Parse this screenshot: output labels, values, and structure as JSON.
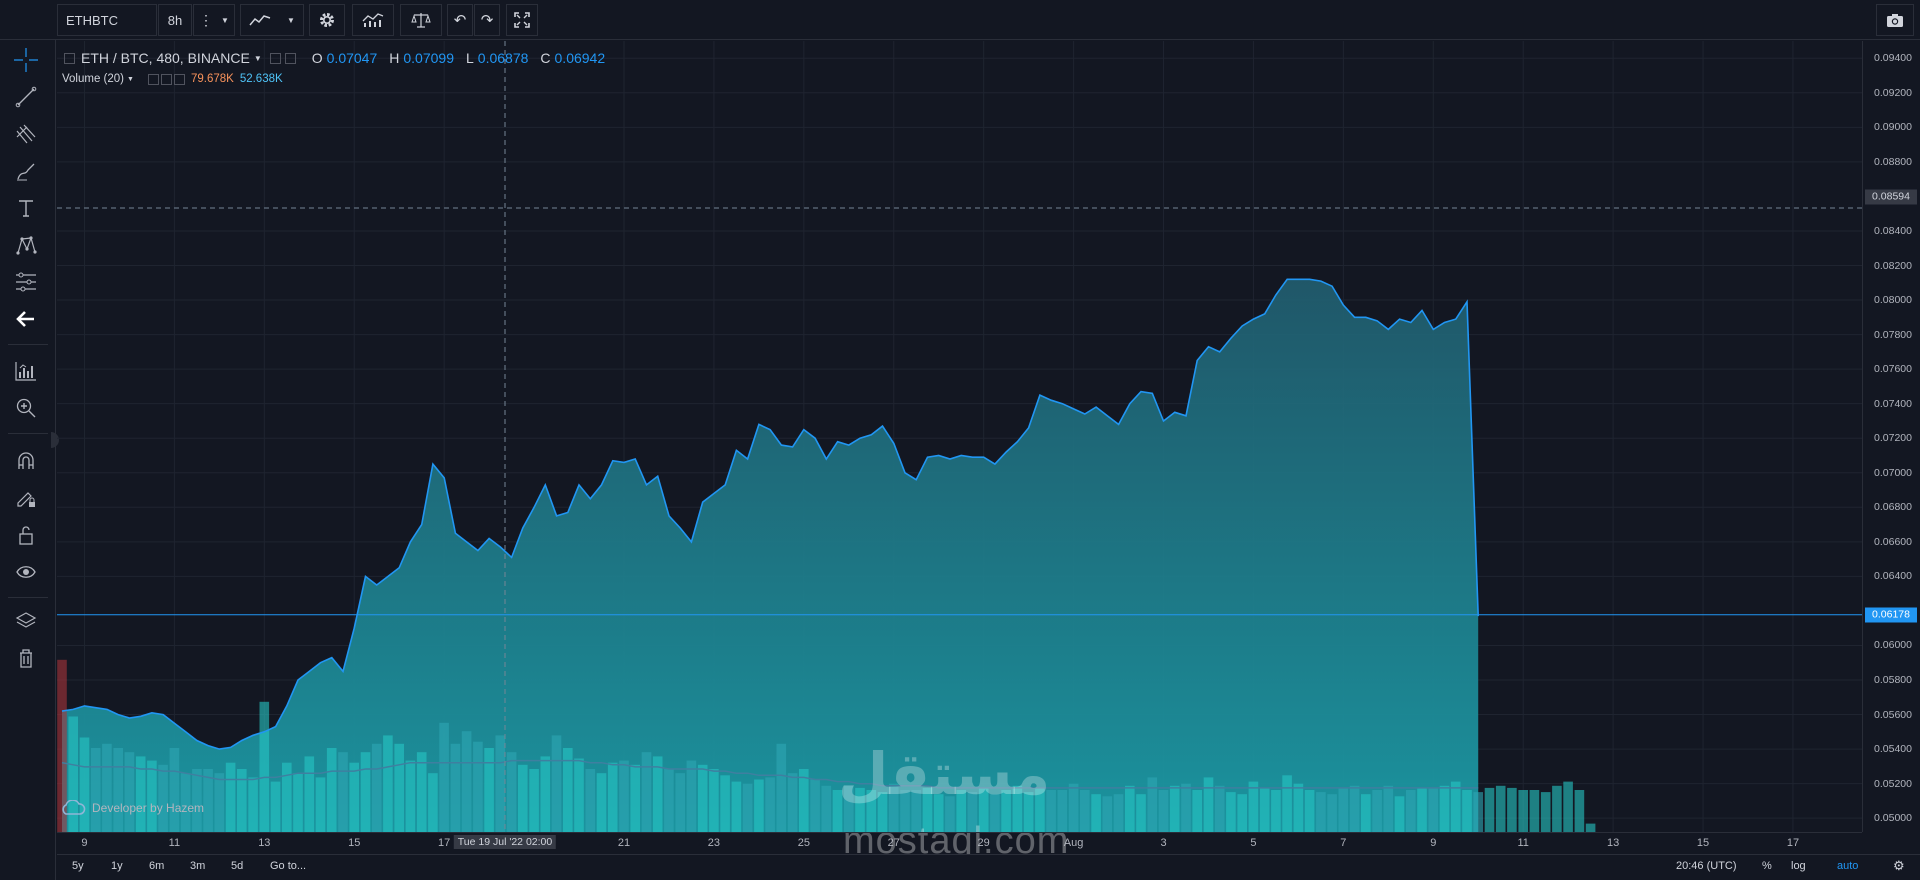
{
  "toolbar": {
    "symbol": "ETHBTC",
    "interval": "8h",
    "icons": [
      "more-dots-icon",
      "chevron-down-icon",
      "line-chart-icon",
      "chevron-down-icon",
      "gear-icon",
      "indicators-icon",
      "compare-scale-icon",
      "undo-icon",
      "redo-icon",
      "fullscreen-icon",
      "camera-icon"
    ]
  },
  "left_tools": [
    "crosshair-icon",
    "trend-line-icon",
    "pitchfork-icon",
    "brush-icon",
    "text-icon",
    "pattern-icon",
    "measure-icon",
    "back-arrow-icon",
    "long-position-icon",
    "zoom-in-icon",
    "magnet-icon",
    "lock-drawing-icon",
    "unlock-icon",
    "eye-icon",
    "layers-icon",
    "trash-icon"
  ],
  "legend": {
    "title": "ETH / BTC, 480, BINANCE",
    "o_key": "O",
    "o_val": "0.07047",
    "h_key": "H",
    "h_val": "0.07099",
    "l_key": "L",
    "l_val": "0.06878",
    "c_key": "C",
    "c_val": "0.06942",
    "volume_title": "Volume (20)",
    "volume_val": "79.678K",
    "volume_ma": "52.638K"
  },
  "price_axis": {
    "labels": [
      "0.09400",
      "0.09200",
      "0.09000",
      "0.08800",
      "0.08400",
      "0.08200",
      "0.08000",
      "0.07800",
      "0.07600",
      "0.07400",
      "0.07200",
      "0.07000",
      "0.06800",
      "0.06600",
      "0.06400",
      "0.06000",
      "0.05800",
      "0.05600",
      "0.05400",
      "0.05200",
      "0.05000"
    ],
    "crosshair_price": "0.08594",
    "last_price": "0.06178"
  },
  "time_axis": {
    "labels": [
      "9",
      "11",
      "13",
      "15",
      "17",
      "21",
      "23",
      "25",
      "27",
      "29",
      "Aug",
      "3",
      "5",
      "7",
      "9",
      "11",
      "13",
      "15",
      "17",
      "29"
    ],
    "crosshair_time": "Tue 19 Jul '22 02:00"
  },
  "bottom_bar": {
    "ranges": [
      "5y",
      "1y",
      "6m",
      "3m",
      "5d"
    ],
    "goto": "Go to...",
    "clock": "20:46 (UTC)",
    "percent": "%",
    "log": "log",
    "auto": "auto"
  },
  "watermark": {
    "credit": "Developer by Hazem",
    "site": "mostaql.com",
    "arabic": "مستقل"
  },
  "colors": {
    "background": "#131722",
    "line": "#2196f3",
    "area": "#1e6e7e",
    "volume_up": "#26c6c4",
    "volume_down": "#2ea7b4",
    "volume_first": "#a9343a",
    "volume_ma": "#3f7fa0",
    "last_price_tag": "#2196f3",
    "legend_volume_val": "#f7925b",
    "legend_volume_ma": "#4fc3f7"
  },
  "chart_data": {
    "type": "area",
    "ylim": [
      0.0492,
      0.095
    ],
    "price": [
      0.0562,
      0.0563,
      0.0565,
      0.0564,
      0.0563,
      0.056,
      0.0558,
      0.0559,
      0.0561,
      0.056,
      0.0555,
      0.055,
      0.0545,
      0.0542,
      0.054,
      0.0541,
      0.0545,
      0.0548,
      0.055,
      0.0553,
      0.0565,
      0.058,
      0.0585,
      0.059,
      0.0593,
      0.0585,
      0.061,
      0.064,
      0.0635,
      0.064,
      0.0645,
      0.066,
      0.067,
      0.0705,
      0.0697,
      0.0665,
      0.066,
      0.0655,
      0.0662,
      0.0657,
      0.0651,
      0.0668,
      0.068,
      0.0693,
      0.0675,
      0.0677,
      0.0693,
      0.0685,
      0.0693,
      0.0707,
      0.0706,
      0.0708,
      0.0693,
      0.0698,
      0.0675,
      0.0668,
      0.066,
      0.0683,
      0.0688,
      0.0693,
      0.0713,
      0.0708,
      0.0728,
      0.0725,
      0.0716,
      0.0715,
      0.0725,
      0.072,
      0.0708,
      0.0718,
      0.0716,
      0.072,
      0.0722,
      0.0727,
      0.0717,
      0.07,
      0.0696,
      0.0709,
      0.071,
      0.0708,
      0.071,
      0.0709,
      0.0709,
      0.0705,
      0.0712,
      0.0718,
      0.0726,
      0.0745,
      0.0742,
      0.074,
      0.0737,
      0.0734,
      0.0738,
      0.0733,
      0.0728,
      0.074,
      0.0747,
      0.0746,
      0.073,
      0.0735,
      0.0733,
      0.0765,
      0.0773,
      0.077,
      0.0778,
      0.0785,
      0.0789,
      0.0792,
      0.0803,
      0.0812,
      0.0812,
      0.0812,
      0.0811,
      0.0808,
      0.0797,
      0.079,
      0.079,
      0.0788,
      0.0783,
      0.0789,
      0.0787,
      0.0794,
      0.0783,
      0.0787,
      0.0789,
      0.0799,
      0.0617
    ],
    "volume": [
      0.82,
      0.55,
      0.45,
      0.4,
      0.42,
      0.4,
      0.38,
      0.36,
      0.34,
      0.32,
      0.4,
      0.28,
      0.3,
      0.3,
      0.28,
      0.33,
      0.3,
      0.26,
      0.62,
      0.24,
      0.33,
      0.28,
      0.36,
      0.26,
      0.4,
      0.38,
      0.33,
      0.38,
      0.42,
      0.46,
      0.42,
      0.34,
      0.38,
      0.28,
      0.52,
      0.42,
      0.48,
      0.43,
      0.4,
      0.46,
      0.38,
      0.32,
      0.3,
      0.36,
      0.46,
      0.4,
      0.35,
      0.3,
      0.28,
      0.33,
      0.34,
      0.32,
      0.38,
      0.36,
      0.3,
      0.28,
      0.34,
      0.32,
      0.3,
      0.27,
      0.24,
      0.23,
      0.25,
      0.26,
      0.42,
      0.28,
      0.3,
      0.25,
      0.22,
      0.2,
      0.22,
      0.21,
      0.2,
      0.19,
      0.23,
      0.2,
      0.2,
      0.21,
      0.18,
      0.17,
      0.2,
      0.19,
      0.21,
      0.18,
      0.2,
      0.22,
      0.19,
      0.21,
      0.2,
      0.2,
      0.23,
      0.2,
      0.18,
      0.17,
      0.18,
      0.22,
      0.18,
      0.26,
      0.2,
      0.22,
      0.23,
      0.2,
      0.26,
      0.22,
      0.19,
      0.18,
      0.24,
      0.21,
      0.2,
      0.27,
      0.23,
      0.2,
      0.19,
      0.18,
      0.21,
      0.22,
      0.18,
      0.2,
      0.22,
      0.17,
      0.2,
      0.21,
      0.21,
      0.22,
      0.24,
      0.2,
      0.19,
      0.21,
      0.22,
      0.21,
      0.2,
      0.2,
      0.19,
      0.22,
      0.24,
      0.2,
      0.04
    ],
    "volume_ma": [
      0.33,
      0.32,
      0.31,
      0.31,
      0.31,
      0.31,
      0.31,
      0.3,
      0.3,
      0.29,
      0.29,
      0.28,
      0.27,
      0.26,
      0.25,
      0.25,
      0.25,
      0.25,
      0.26,
      0.26,
      0.27,
      0.28,
      0.28,
      0.28,
      0.29,
      0.29,
      0.29,
      0.3,
      0.3,
      0.31,
      0.32,
      0.33,
      0.33,
      0.33,
      0.33,
      0.33,
      0.33,
      0.33,
      0.33,
      0.33,
      0.34,
      0.34,
      0.34,
      0.34,
      0.34,
      0.34,
      0.34,
      0.33,
      0.33,
      0.32,
      0.32,
      0.31,
      0.31,
      0.31,
      0.3,
      0.3,
      0.3,
      0.3,
      0.29,
      0.29,
      0.28,
      0.28,
      0.27,
      0.27,
      0.27,
      0.26,
      0.26,
      0.25,
      0.25,
      0.24,
      0.24,
      0.23,
      0.23,
      0.22,
      0.22,
      0.22,
      0.22,
      0.22,
      0.21,
      0.21,
      0.21,
      0.21,
      0.21,
      0.21,
      0.21,
      0.21,
      0.21,
      0.21,
      0.21,
      0.21,
      0.21,
      0.21,
      0.21,
      0.21,
      0.21,
      0.21,
      0.21,
      0.21,
      0.21,
      0.21,
      0.21,
      0.21,
      0.21,
      0.21,
      0.21,
      0.21,
      0.21,
      0.21,
      0.21,
      0.21,
      0.21,
      0.21,
      0.21,
      0.21,
      0.21,
      0.21,
      0.21,
      0.21,
      0.21,
      0.21,
      0.21,
      0.21,
      0.21,
      0.21,
      0.21,
      0.21,
      0.21,
      0.21,
      0.21,
      0.21,
      0.21,
      0.21,
      0.21,
      0.21,
      0.21,
      0.21,
      0.21
    ]
  }
}
